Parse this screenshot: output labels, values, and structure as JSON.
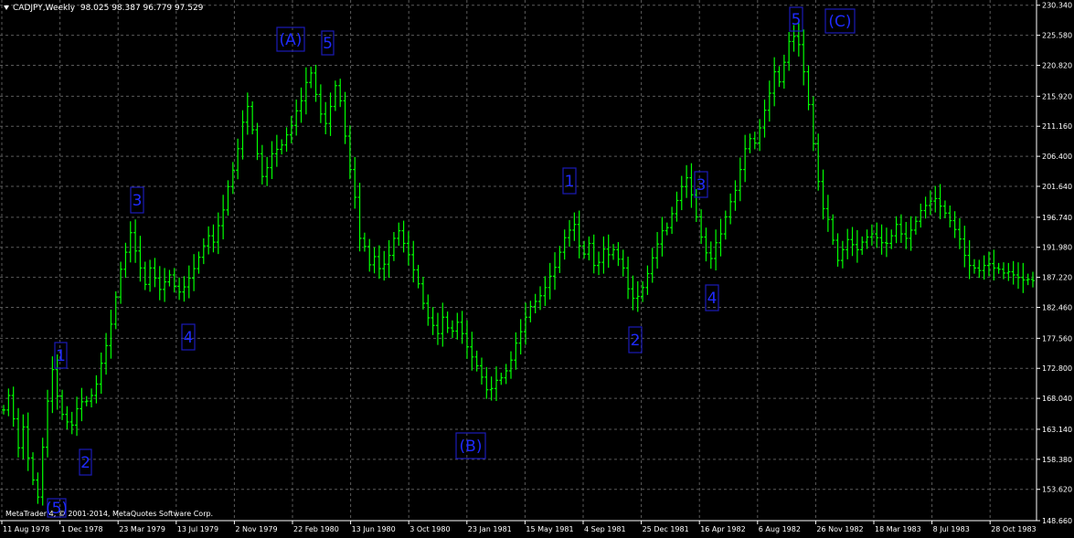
{
  "header": {
    "symbol": "CADJPY,Weekly",
    "ohlc": "98.025 98.387 96.779 97.529"
  },
  "footer": {
    "copyright": "MetaTrader 4, © 2001-2014, MetaQuotes Software Corp."
  },
  "colors": {
    "background": "#000000",
    "grid": "#5a5a5a",
    "candle": "#00ff00",
    "label_box": "#1b1bb8",
    "label_text": "#1f2bff",
    "axis_text": "#ffffff"
  },
  "chart_data": {
    "type": "bar",
    "title": "CADJPY,Weekly",
    "ylim": [
      148.66,
      231.17
    ],
    "y_ticks": [
      "230.340",
      "225.580",
      "220.820",
      "215.920",
      "211.160",
      "206.400",
      "201.640",
      "196.740",
      "191.980",
      "187.220",
      "182.460",
      "177.560",
      "172.800",
      "168.040",
      "163.140",
      "158.380",
      "153.620",
      "148.660"
    ],
    "x_ticks": [
      "11 Aug 1978",
      "1 Dec 1978",
      "23 Mar 1979",
      "13 Jul 1979",
      "2 Nov 1979",
      "22 Feb 1980",
      "13 Jun 1980",
      "3 Oct 1980",
      "23 Jan 1981",
      "15 May 1981",
      "4 Sep 1981",
      "25 Dec 1981",
      "16 Apr 1982",
      "6 Aug 1982",
      "26 Nov 1982",
      "18 Mar 1983",
      "8 Jul 1983",
      "28 Oct 1983"
    ],
    "grid": true,
    "series": [
      {
        "values": [
          166.2,
          168.5,
          164.8,
          160.2,
          163.5,
          158.6,
          155.1,
          152.4,
          160.3,
          167.6,
          172.6,
          168.4,
          165.5,
          164.3,
          163.8,
          166.4,
          167.5,
          167.6,
          168.5,
          170.3,
          173.6,
          176.4,
          179.8,
          184.1,
          188.5,
          191.2,
          194.3,
          191.4,
          188.7,
          186.1,
          188.7,
          187.1,
          185.3,
          186.5,
          187.6,
          185.8,
          184.9,
          185.7,
          187.1,
          188.6,
          190.4,
          192.2,
          193.8,
          192.8,
          195.4,
          197.9,
          201.6,
          204.2,
          207.6,
          211.8,
          214.3,
          210.6,
          206.8,
          203.2,
          204.6,
          206.8,
          207.5,
          208.2,
          209.8,
          211.3,
          213.6,
          215.2,
          218.1,
          219.6,
          216.2,
          213.1,
          211.6,
          214.3,
          217.6,
          215.2,
          209.6,
          204.3,
          199.9,
          193.4,
          192.1,
          189.2,
          190.5,
          188.6,
          189.3,
          190.7,
          193.4,
          194.6,
          192.6,
          190.8,
          188.4,
          186.2,
          183.1,
          180.8,
          179.6,
          178.3,
          180.9,
          179.2,
          178.7,
          180.1,
          178.3,
          176.2,
          174.6,
          173.2,
          171.4,
          169.4,
          169.6,
          170.9,
          171.3,
          172.4,
          174.1,
          176.8,
          178.6,
          180.9,
          182.6,
          183.4,
          184.3,
          185.6,
          187.4,
          188.8,
          191.2,
          193.5,
          194.7,
          195.6,
          192.2,
          190.9,
          192.6,
          189.1,
          189.6,
          191.7,
          190.8,
          191.6,
          190.1,
          188.7,
          185.4,
          183.9,
          184.2,
          185.6,
          187.8,
          190.3,
          192.5,
          194.6,
          195.1,
          197.3,
          199.4,
          201.6,
          203.0,
          200.3,
          196.8,
          193.6,
          191.1,
          190.2,
          192.7,
          194.1,
          196.8,
          199.2,
          201.0,
          204.3,
          207.6,
          209.2,
          208.5,
          210.9,
          213.7,
          216.4,
          219.8,
          218.2,
          221.3,
          224.6,
          225.4,
          224.1,
          219.8,
          214.6,
          208.4,
          202.4,
          198.1,
          196.4,
          193.1,
          189.9,
          191.6,
          193.2,
          192.4,
          191.6,
          192.8,
          193.6,
          194.1,
          193.5,
          192.7,
          192.6,
          193.8,
          195.6,
          194.1,
          193.4,
          194.7,
          196.1,
          197.8,
          198.6,
          199.3,
          199.7,
          198.5,
          197.4,
          196.2,
          194.8,
          193.3,
          190.7,
          189.1,
          188.7,
          188.3,
          189.1,
          189.4,
          188.7,
          188.5,
          187.9,
          188.1,
          187.6,
          187.2,
          186.8,
          186.9,
          186.7
        ]
      }
    ]
  },
  "wave_labels": [
    {
      "text": "(5)"
    },
    {
      "text": "1"
    },
    {
      "text": "2"
    },
    {
      "text": "3"
    },
    {
      "text": "4"
    },
    {
      "text": "(A)"
    },
    {
      "text": "5"
    },
    {
      "text": "(B)"
    },
    {
      "text": "1"
    },
    {
      "text": "2"
    },
    {
      "text": "3"
    },
    {
      "text": "4"
    },
    {
      "text": "5"
    },
    {
      "text": "(C)"
    }
  ]
}
